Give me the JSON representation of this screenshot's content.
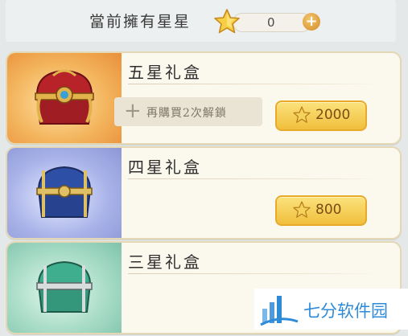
{
  "header": {
    "owned_label": "當前擁有星星",
    "star_count": "0"
  },
  "boxes": [
    {
      "title": "五星礼盒",
      "unlock_text": "再購買2次解鎖",
      "price": "2000",
      "theme": "#f0a24a"
    },
    {
      "title": "四星礼盒",
      "price": "800",
      "theme": "#a3acdf"
    },
    {
      "title": "三星礼盒",
      "theme": "#9fd4be"
    }
  ],
  "watermark": {
    "text": "七分软件园"
  },
  "colors": {
    "gold": "#f1bf3c",
    "price_text": "#7a4d16",
    "accent_plus": "#d18a2a"
  }
}
